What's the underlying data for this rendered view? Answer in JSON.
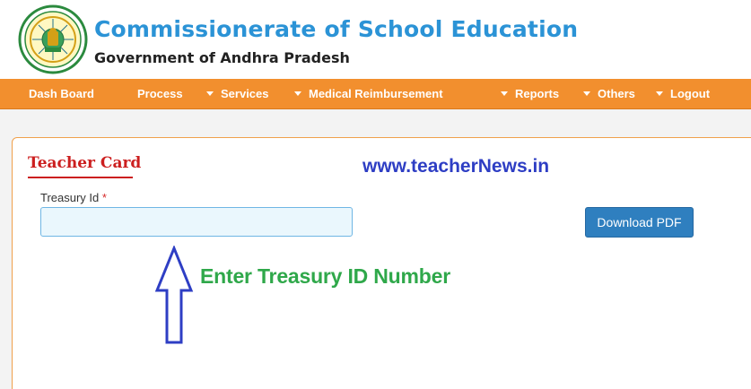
{
  "header": {
    "logo_icon": "andhra-pradesh-emblem-icon",
    "title": "Commissionerate of School Education",
    "subtitle": "Government of Andhra Pradesh",
    "title_color": "#2b93d6"
  },
  "nav": {
    "background": "#f28f2e",
    "items": [
      {
        "label": "Dash Board",
        "has_caret": false
      },
      {
        "label": "Process",
        "has_caret": false
      },
      {
        "label": "Services",
        "has_caret": true
      },
      {
        "label": "Medical Reimbursement",
        "has_caret": true
      },
      {
        "label": "Reports",
        "has_caret": true
      },
      {
        "label": "Others",
        "has_caret": true
      },
      {
        "label": "Logout",
        "has_caret": true
      }
    ]
  },
  "panel": {
    "title": "Teacher Card",
    "watermark": "www.teacherNews.in",
    "field": {
      "label": "Treasury Id",
      "required_mark": "*",
      "value": "",
      "placeholder": ""
    },
    "download_button": "Download PDF",
    "annotation": {
      "text": "Enter Treasury ID Number",
      "arrow_icon": "up-arrow-icon"
    }
  }
}
